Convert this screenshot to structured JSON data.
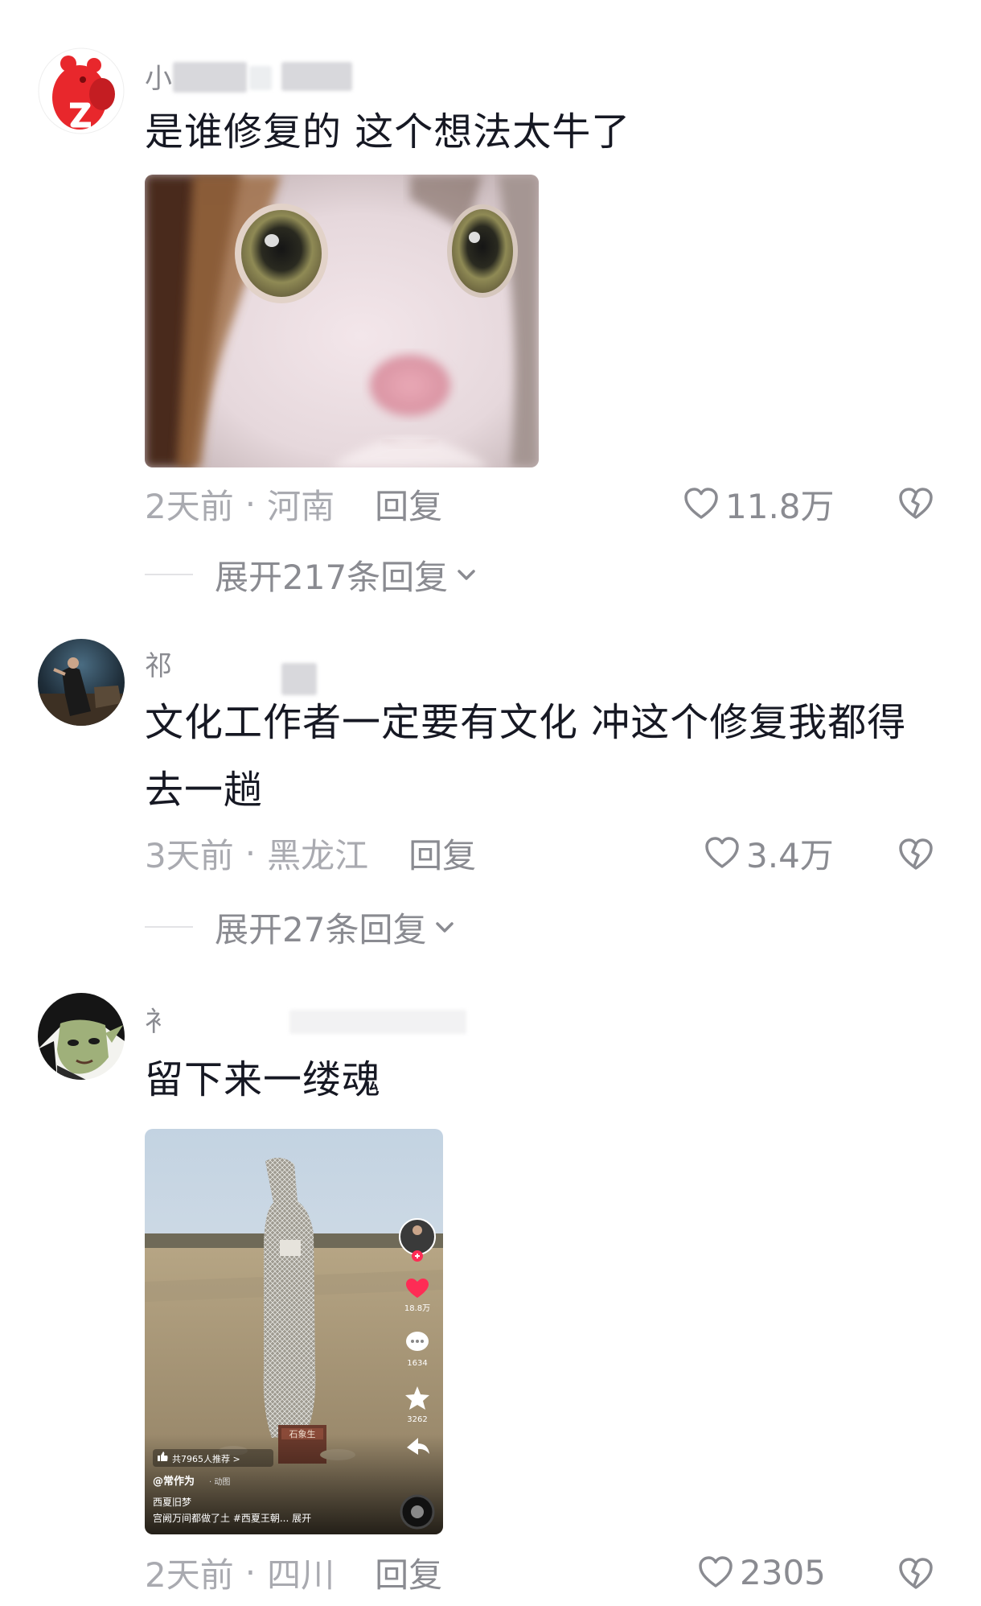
{
  "comments": [
    {
      "username": "小",
      "text": "是谁修复的 这个想法太牛了",
      "time": "2天前",
      "location": "河南",
      "reply_label": "回复",
      "likes": "11.8万",
      "expand_label": "展开217条回复",
      "avatar_icon": "red-bear-avatar",
      "image_icon": "cat-face-sticker"
    },
    {
      "username": "祁",
      "text": "文化工作者一定要有文化 冲这个修复我都得去一趟",
      "time": "3天前",
      "location": "黑龙江",
      "reply_label": "回复",
      "likes": "3.4万",
      "expand_label": "展开27条回复",
      "avatar_icon": "night-photo-avatar"
    },
    {
      "username": "衤",
      "text": "留下来一缕魂",
      "time": "2天前",
      "location": "四川",
      "reply_label": "回复",
      "likes": "2305",
      "avatar_icon": "green-elf-avatar",
      "video_card": {
        "side_likes": "18.8万",
        "side_comments": "1634",
        "side_stars": "3262",
        "recommend": "共7965人推荐 >",
        "author": "@常作为",
        "author_tag": "· 动图",
        "title": "西夏旧梦",
        "desc": "宫阙万间都做了土 #西夏王朝... 展开",
        "plaque": "石象生"
      }
    }
  ],
  "colors": {
    "text": "#161823",
    "meta": "#a9aab0",
    "secondary": "#8a8b91",
    "like_pink": "#fe2c55"
  }
}
